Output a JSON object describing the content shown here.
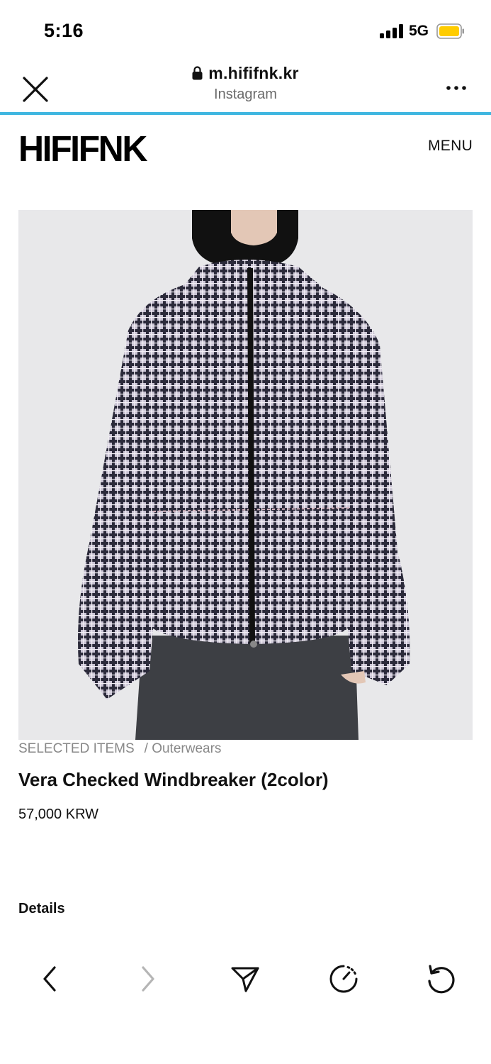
{
  "status_bar": {
    "time": "5:16",
    "network": "5G",
    "battery_color": "#ffcc00"
  },
  "browser": {
    "url": "m.hififnk.kr",
    "source": "Instagram",
    "accent_color": "#3fb6e0",
    "icons": [
      "close-icon",
      "lock-icon",
      "more-icon"
    ]
  },
  "site": {
    "logo": "HIFIFNK",
    "menu_label": "MENU"
  },
  "product": {
    "image_alt": "checked-windbreaker-photo",
    "breadcrumb": [
      "SELECTED ITEMS",
      "/ Outerwears"
    ],
    "title": "Vera Checked Windbreaker (2color)",
    "price": "57,000 KRW",
    "details_label": "Details"
  },
  "toolbar": {
    "icons": [
      "back-icon",
      "forward-icon",
      "share-icon",
      "speed-icon",
      "reload-icon"
    ]
  }
}
